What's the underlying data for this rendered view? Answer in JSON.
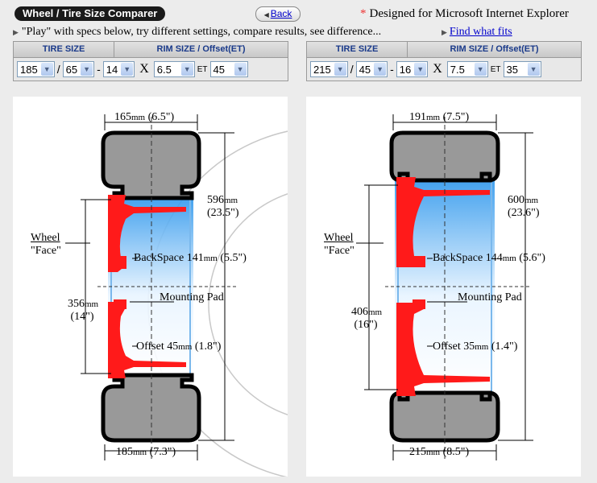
{
  "header": {
    "title": "Wheel / Tire Size Comparer",
    "back_label": "Back",
    "designed_note": "Designed for Microsoft Internet Explorer",
    "instructions": "\"Play\" with specs below, try different settings, compare results, see difference...",
    "find_link": "Find what fits"
  },
  "table_headers": {
    "tire": "TIRE SIZE",
    "rim": "RIM SIZE / Offset(ET)"
  },
  "left": {
    "width": "185",
    "aspect": "65",
    "rim_diam": "14",
    "rim_width": "6.5",
    "et": "45",
    "et_label": "ET",
    "labels": {
      "top_width_mm": "165",
      "top_width_in": "(6.5\")",
      "diam_mm": "596",
      "diam_in": "(23.5\")",
      "face1": "Wheel",
      "face2": "\"Face\"",
      "backspace": "BackSpace 141",
      "backspace_in": "(5.5\")",
      "mounting": "Mounting Pad",
      "rim_mm": "356",
      "rim_in": "(14\")",
      "offset": "Offset 45",
      "offset_in": "(1.8\")",
      "bot_width_mm": "185",
      "bot_width_in": "(7.3\")",
      "unit": "mm"
    }
  },
  "right": {
    "width": "215",
    "aspect": "45",
    "rim_diam": "16",
    "rim_width": "7.5",
    "et": "35",
    "et_label": "ET",
    "labels": {
      "top_width_mm": "191",
      "top_width_in": "(7.5\")",
      "diam_mm": "600",
      "diam_in": "(23.6\")",
      "face1": "Wheel",
      "face2": "\"Face\"",
      "backspace": "BackSpace 144",
      "backspace_in": "(5.6\")",
      "mounting": "Mounting Pad",
      "rim_mm": "406",
      "rim_in": "(16\")",
      "offset": "Offset 35",
      "offset_in": "(1.4\")",
      "bot_width_mm": "215",
      "bot_width_in": "(8.5\")",
      "unit": "mm"
    }
  },
  "colors": {
    "wheel_red": "#ff1a1a",
    "tire_gray": "#999999",
    "rim_blue": "#3aa0ee"
  }
}
